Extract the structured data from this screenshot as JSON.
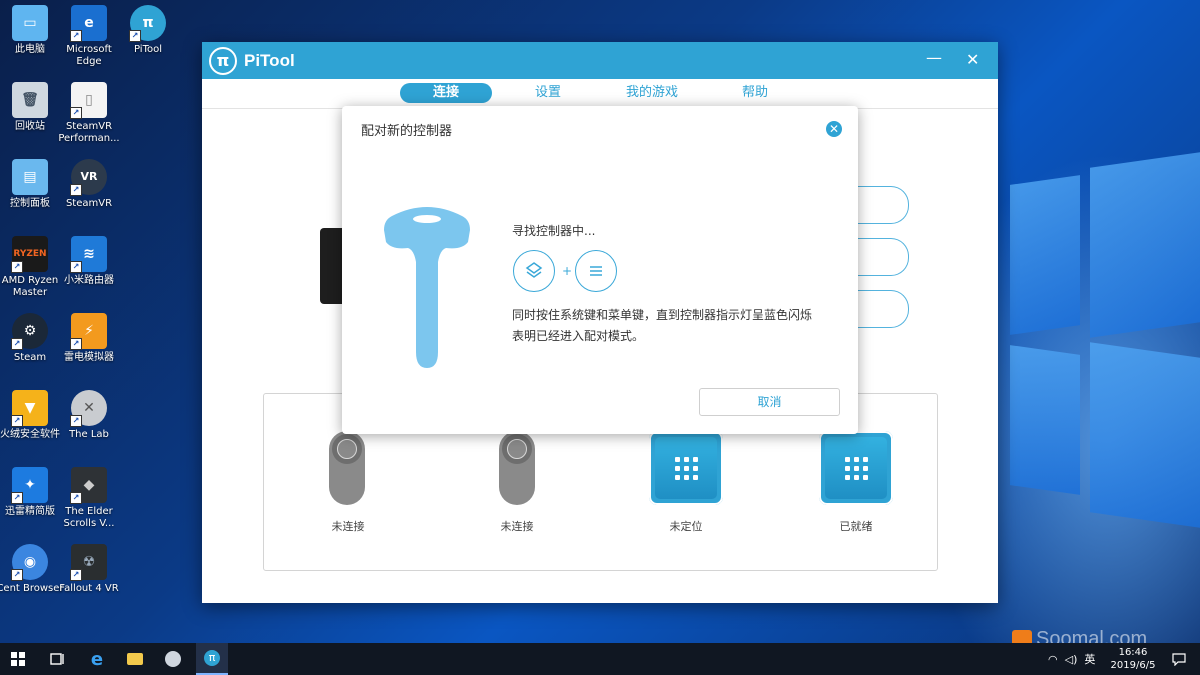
{
  "desktop": {
    "icons": [
      {
        "label": "此电脑"
      },
      {
        "label": "Microsoft Edge"
      },
      {
        "label": "PiTool"
      },
      {
        "label": "回收站"
      },
      {
        "label": "SteamVR Performan..."
      },
      {
        "label": "控制面板"
      },
      {
        "label": "SteamVR"
      },
      {
        "label": "AMD Ryzen Master"
      },
      {
        "label": "小米路由器"
      },
      {
        "label": "Steam"
      },
      {
        "label": "雷电模拟器"
      },
      {
        "label": "火绒安全软件"
      },
      {
        "label": "The Lab"
      },
      {
        "label": "迅雷精简版"
      },
      {
        "label": "The Elder Scrolls V..."
      },
      {
        "label": "Cent Browser"
      },
      {
        "label": "Fallout 4 VR"
      }
    ]
  },
  "window": {
    "title": "PiTool",
    "minimize": "—",
    "close": "✕",
    "tabs": [
      {
        "label": "连接",
        "active": true
      },
      {
        "label": "设置"
      },
      {
        "label": "我的游戏"
      },
      {
        "label": "帮助"
      }
    ],
    "devices": [
      {
        "label": "未连接"
      },
      {
        "label": "未连接"
      },
      {
        "label": "未定位"
      },
      {
        "label": "已就绪"
      }
    ]
  },
  "modal": {
    "title": "配对新的控制器",
    "searching": "寻找控制器中...",
    "instruction_line1": "同时按住系统键和菜单键，直到控制器指示灯呈蓝色闪烁",
    "instruction_line2": "表明已经进入配对模式。",
    "plus": "+",
    "cancel": "取消"
  },
  "taskbar": {
    "time": "16:46",
    "date": "2019/6/5",
    "ime": "英"
  },
  "watermark": "Soomal.com",
  "colors": {
    "accent": "#2fa3d4",
    "controller": "#7cc6ee"
  }
}
